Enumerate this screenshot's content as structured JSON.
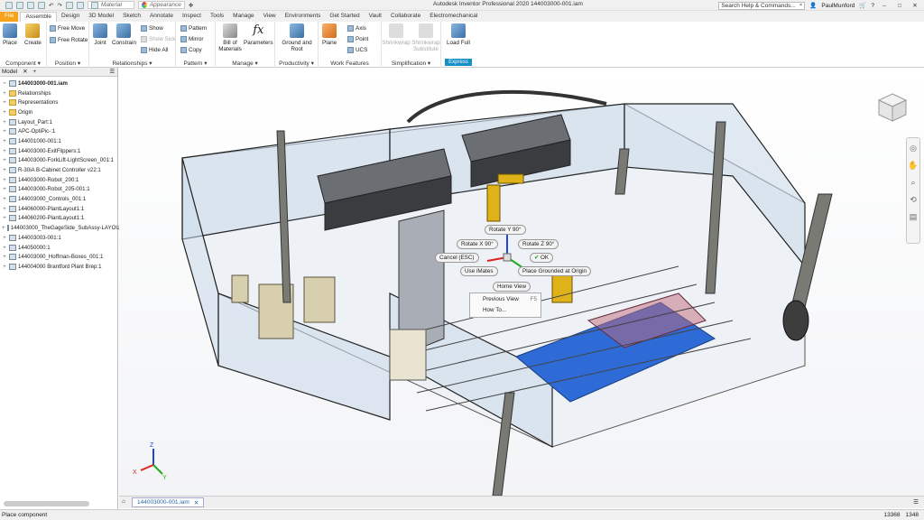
{
  "title_bar": {
    "app_title": "Autodesk Inventor Professional 2020  144003000-001.iam",
    "material_label": "Material",
    "appearance_label": "Appearance",
    "search_placeholder": "Search Help & Commands...",
    "user": "PaulMunford"
  },
  "tabs": [
    "File",
    "Assemble",
    "Design",
    "3D Model",
    "Sketch",
    "Annotate",
    "Inspect",
    "Tools",
    "Manage",
    "View",
    "Environments",
    "Get Started",
    "Vault",
    "Collaborate",
    "Electromechanical"
  ],
  "active_tab": "Assemble",
  "ribbon": {
    "component": {
      "label": "Component",
      "place": "Place",
      "create": "Create"
    },
    "position": {
      "label": "Position",
      "free_move": "Free Move",
      "free_rotate": "Free Rotate"
    },
    "relationships": {
      "label": "Relationships",
      "joint": "Joint",
      "constrain": "Constrain",
      "show": "Show",
      "show_sick": "Show Sick",
      "hide_all": "Hide All"
    },
    "pattern": {
      "label": "Pattern",
      "pattern": "Pattern",
      "mirror": "Mirror",
      "copy": "Copy"
    },
    "manage": {
      "label": "Manage",
      "bom": "Bill of Materials",
      "parameters": "Parameters"
    },
    "productivity": {
      "label": "Productivity",
      "ground_root": "Ground and Root"
    },
    "work_features": {
      "label": "Work Features",
      "plane": "Plane",
      "axis": "Axis",
      "point": "Point",
      "ucs": "UCS"
    },
    "simplification": {
      "label": "Simplification",
      "shrinkwrap": "Shrinkwrap",
      "shrinkwrap_substitute": "Shrinkwrap Substitute"
    },
    "express": {
      "label": "Express",
      "load_full": "Load Full"
    }
  },
  "browser": {
    "header": "Model",
    "root": "144003000-001.iam",
    "nodes": [
      {
        "label": "Relationships",
        "icon": "folder-icon"
      },
      {
        "label": "Representations",
        "icon": "folder-icon"
      },
      {
        "label": "Origin",
        "icon": "folder-icon"
      },
      {
        "label": "Layout_Part:1",
        "icon": "part-icon"
      },
      {
        "label": "APC-OptiPic-:1",
        "icon": "part-icon"
      },
      {
        "label": "144001000-001:1",
        "icon": "assembly-icon"
      },
      {
        "label": "144003000-ExitFlippers:1",
        "icon": "assembly-icon"
      },
      {
        "label": "144003000-ForkLift-LightScreen_001:1",
        "icon": "assembly-icon"
      },
      {
        "label": "R-30iA B-Cabinet Controller v22:1",
        "icon": "assembly-icon"
      },
      {
        "label": "144003000-Robot_200:1",
        "icon": "assembly-icon"
      },
      {
        "label": "144003000-Robot_205-001:1",
        "icon": "assembly-icon"
      },
      {
        "label": "144003000_Controls_001:1",
        "icon": "assembly-icon"
      },
      {
        "label": "144060000-PlantLayout1:1",
        "icon": "assembly-icon"
      },
      {
        "label": "144060200-PlantLayout1:1",
        "icon": "assembly-icon"
      },
      {
        "label": "144003000_TheGageSide_SubAssy-LAYOUT",
        "icon": "assembly-icon"
      },
      {
        "label": "144003003-001:1",
        "icon": "assembly-icon"
      },
      {
        "label": "144050000:1",
        "icon": "assembly-icon"
      },
      {
        "label": "144003000_Hoffman-Boxes_001:1",
        "icon": "assembly-icon"
      },
      {
        "label": "144004000 Brantford Plant Brep:1",
        "icon": "assembly-icon"
      }
    ]
  },
  "marking_menu": {
    "rotate_y": "Rotate Y 90°",
    "rotate_x": "Rotate X 90°",
    "rotate_z": "Rotate Z 90°",
    "cancel": "Cancel (ESC)",
    "ok": "OK",
    "use_imates": "Use iMates",
    "place_grounded": "Place Grounded at Origin",
    "home_view": "Home View"
  },
  "context_menu": {
    "previous_view": "Previous View",
    "previous_view_key": "F5",
    "how_to": "How To..."
  },
  "doc_tab": "144003000-001.iam",
  "status": {
    "text": "Place component",
    "coord_a": "13368",
    "coord_b": "1348"
  },
  "triad": {
    "x": "X",
    "y": "Y",
    "z": "Z"
  },
  "colors": {
    "accent": "#1790c7",
    "file_tab": "#f6a21b",
    "blue_pallet": "#2f6bd6"
  }
}
